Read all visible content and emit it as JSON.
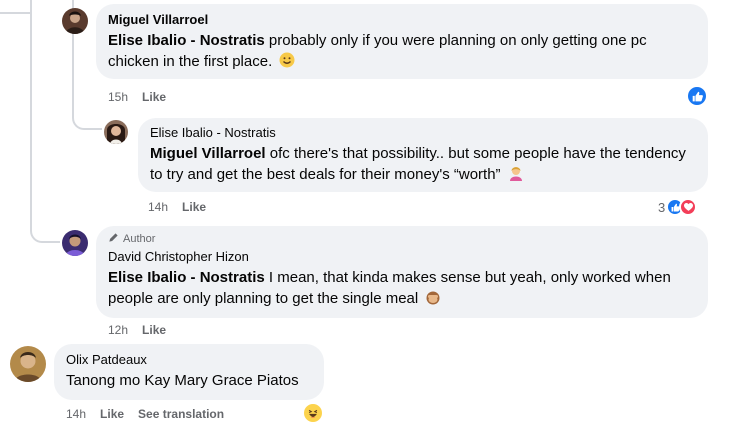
{
  "comments": [
    {
      "author": "Miguel Villarroel",
      "mention": "Elise Ibalio - Nostratis",
      "text": "probably only if you were planning on only getting one pc chicken in the first place.",
      "emoji": "smile-emoji",
      "time": "15h",
      "like_label": "Like",
      "reactions": {
        "icons": [
          "like"
        ],
        "count": ""
      }
    },
    {
      "author": "Elise Ibalio - Nostratis",
      "mention": "Miguel Villarroel",
      "text": "ofc there's that possibility.. but some people have the tendency to try and get the best deals for their money's “worth”",
      "emoji": "woman-gesturing-emoji",
      "time": "14h",
      "like_label": "Like",
      "reactions": {
        "icons": [
          "like",
          "love"
        ],
        "count": "3"
      }
    },
    {
      "badge": "Author",
      "author": "David Christopher Hizon",
      "mention": "Elise Ibalio - Nostratis",
      "text": "I mean, that kinda makes sense but yeah, only worked when people are only planning to get the single meal",
      "emoji": "see-no-evil-monkey-emoji",
      "time": "12h",
      "like_label": "Like",
      "reactions": {
        "icons": [],
        "count": ""
      }
    },
    {
      "author": "Olix Patdeaux",
      "mention": "",
      "text": "Tanong mo Kay Mary Grace Piatos",
      "time": "14h",
      "like_label": "Like",
      "translation_label": "See translation",
      "reactions": {
        "icons": [
          "haha"
        ],
        "count": ""
      }
    }
  ],
  "colors": {
    "like_blue": "#1877f2",
    "love_red": "#f33e58",
    "haha_yellow": "#fcd34d",
    "bubble_bg": "#f0f2f5",
    "meta_gray": "#65676b"
  }
}
